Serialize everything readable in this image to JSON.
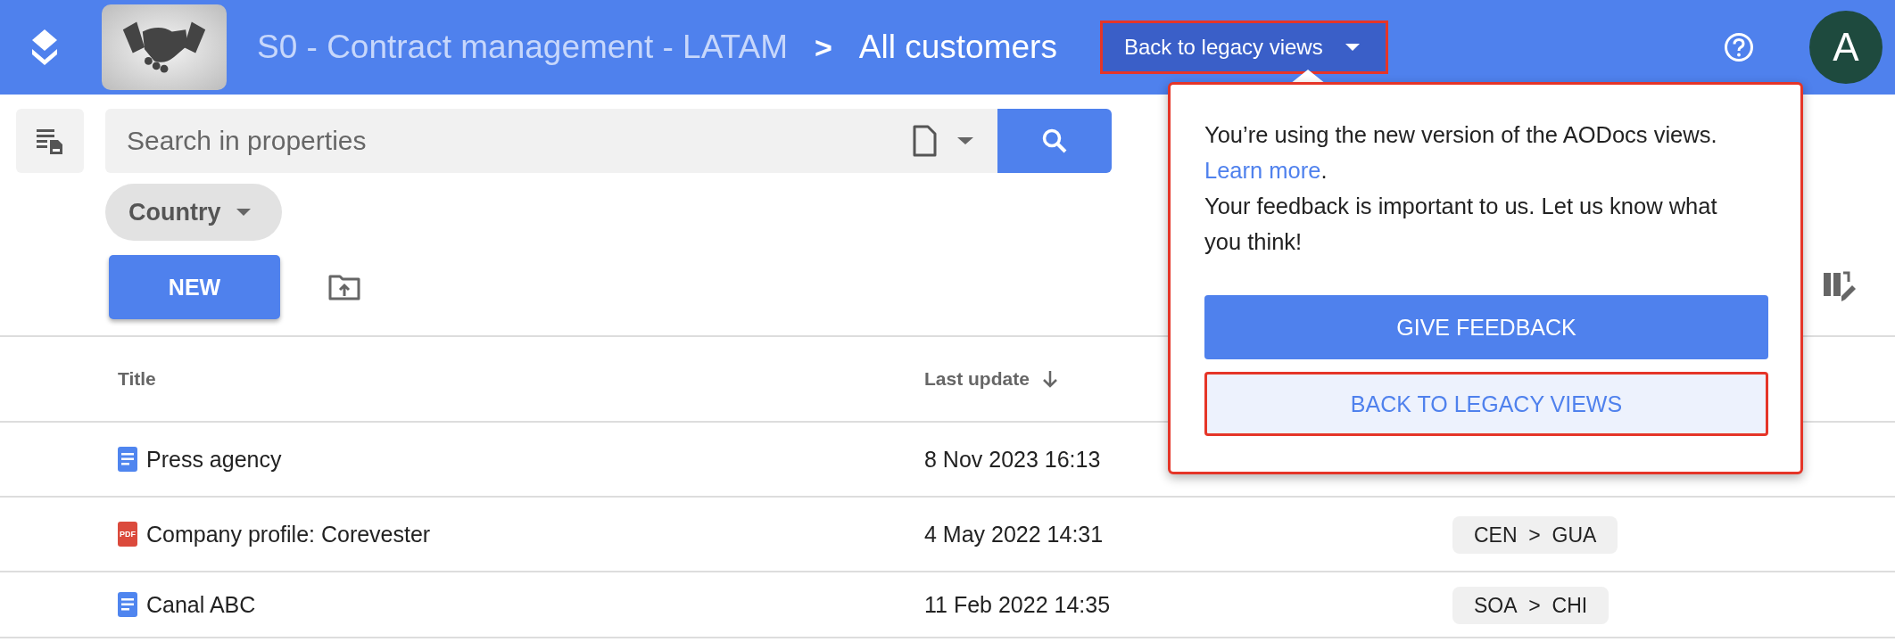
{
  "header": {
    "app_title": "S0 - Contract management - LATAM",
    "separator": ">",
    "current_view": "All customers",
    "legacy_button": {
      "label": "Back to legacy views",
      "highlighted": true
    },
    "avatar": {
      "initial": "A"
    }
  },
  "search": {
    "placeholder": "Search in properties"
  },
  "filters": [
    {
      "label": "Country"
    }
  ],
  "new_button": "NEW",
  "popup": {
    "highlighted": true,
    "message_1": "You’re using the new version of the AODocs views.",
    "link": "Learn more",
    "link_after": ".",
    "message_2": "Your feedback is important to us. Let us know what you think!",
    "buttons": [
      {
        "label": "GIVE FEEDBACK",
        "kind": "primary",
        "highlighted": false
      },
      {
        "label": "BACK TO LEGACY VIEWS",
        "kind": "secondary",
        "highlighted": true
      }
    ]
  },
  "table": {
    "columns": [
      {
        "label": "Title",
        "sorted": false
      },
      {
        "label": "Last update",
        "sorted": true
      }
    ],
    "rows": [
      {
        "kind": "doc",
        "title": "Press agency",
        "last_update": "8 Nov 2023 16:13",
        "tag": null
      },
      {
        "kind": "pdf",
        "title": "Company profile: Corevester",
        "last_update": "4 May 2022 14:31",
        "tag": {
          "from": "CEN",
          "sep": ">",
          "to": "GUA"
        },
        "pdf_label": "PDF"
      },
      {
        "kind": "doc",
        "title": "Canal ABC",
        "last_update": "11 Feb 2022 14:35",
        "tag": {
          "from": "SOA",
          "sep": ">",
          "to": "CHI"
        }
      }
    ]
  }
}
